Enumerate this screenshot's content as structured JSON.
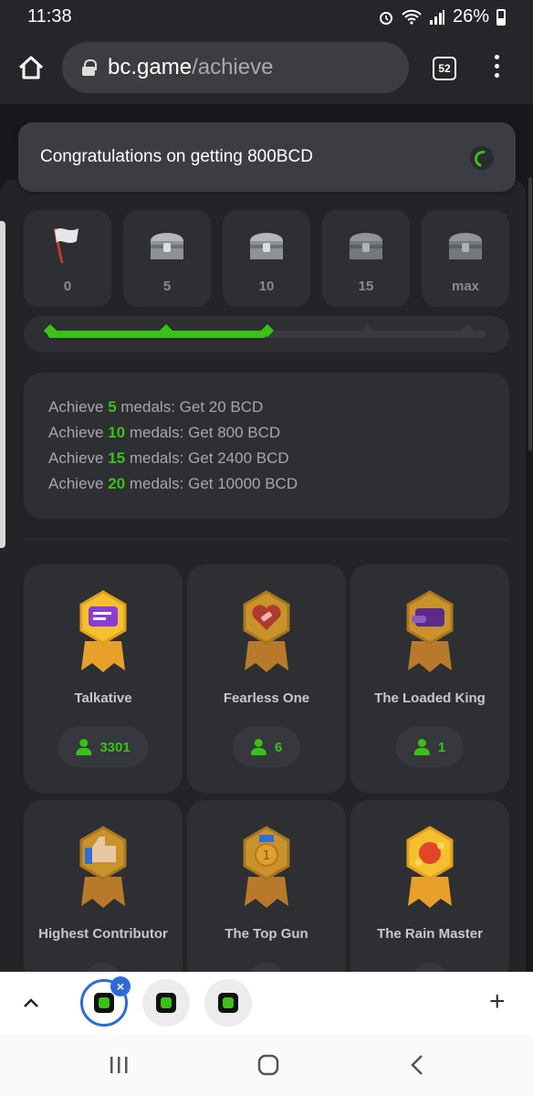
{
  "status_bar": {
    "time": "11:38",
    "battery": "26%"
  },
  "browser": {
    "domain": "bc.game",
    "path": "/achieve",
    "tab_count": "52"
  },
  "toast": {
    "message": "Congratulations on getting 800BCD"
  },
  "milestones": [
    {
      "label": "0",
      "icon": "flag-icon"
    },
    {
      "label": "5",
      "icon": "chest-icon"
    },
    {
      "label": "10",
      "icon": "chest-icon"
    },
    {
      "label": "15",
      "icon": "chest-icon"
    },
    {
      "label": "max",
      "icon": "chest-icon"
    }
  ],
  "progress": {
    "fraction": 0.5,
    "ticks_completed": 3,
    "ticks_total": 5
  },
  "rewards": [
    {
      "prefix": "Achieve ",
      "count": "5",
      "suffix": " medals: Get 20 BCD"
    },
    {
      "prefix": "Achieve ",
      "count": "10",
      "suffix": " medals: Get 800 BCD"
    },
    {
      "prefix": "Achieve ",
      "count": "15",
      "suffix": " medals: Get 2400 BCD"
    },
    {
      "prefix": "Achieve ",
      "count": "20",
      "suffix": " medals: Get 10000 BCD"
    }
  ],
  "medals": [
    {
      "name": "Talkative",
      "count": "3301",
      "icon": "chat-medal-icon"
    },
    {
      "name": "Fearless One",
      "count": "6",
      "icon": "heart-medal-icon"
    },
    {
      "name": "The Loaded King",
      "count": "1",
      "icon": "wallet-medal-icon"
    },
    {
      "name": "Highest Contributor",
      "count": "",
      "icon": "thumbs-up-medal-icon"
    },
    {
      "name": "The Top Gun",
      "count": "",
      "icon": "coin-medal-icon"
    },
    {
      "name": "The Rain Master",
      "count": "",
      "icon": "rain-medal-icon"
    }
  ],
  "colors": {
    "accent": "#3bc117",
    "panel": "#2d2f33",
    "background": "#17181b"
  }
}
